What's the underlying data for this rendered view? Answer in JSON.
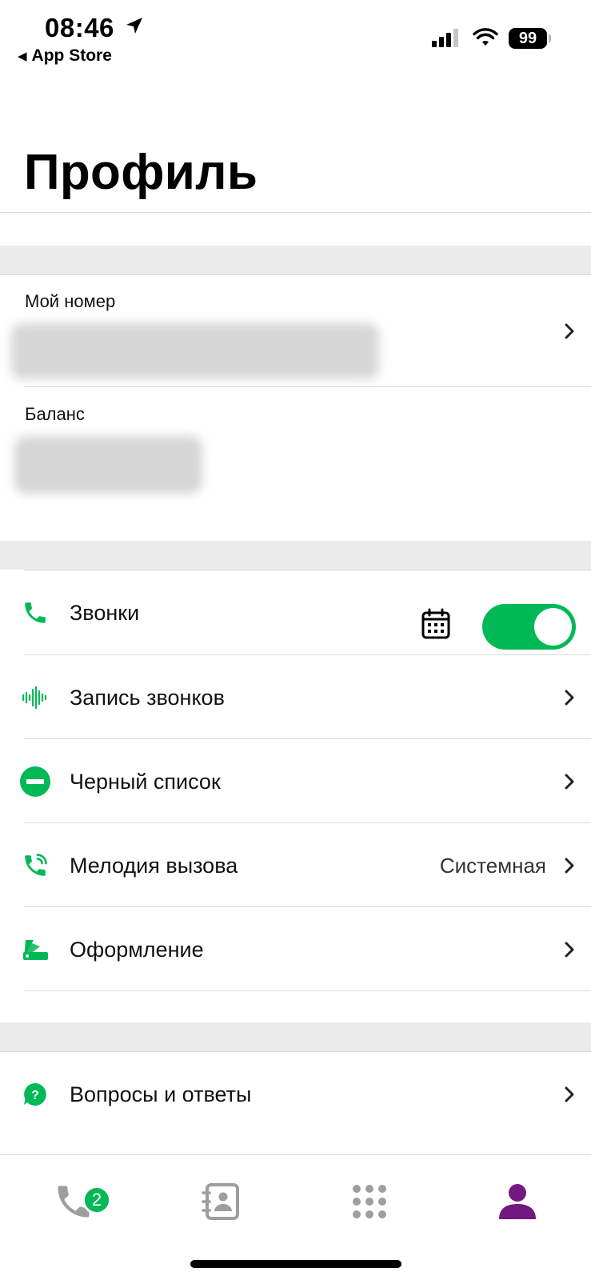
{
  "status_bar": {
    "time": "08:46",
    "back_label": "App Store",
    "battery": "99"
  },
  "page": {
    "title": "Профиль"
  },
  "account": {
    "my_number_label": "Мой номер",
    "balance_label": "Баланс"
  },
  "settings": {
    "calls_label": "Звонки",
    "calls_enabled": true,
    "recording_label": "Запись звонков",
    "blacklist_label": "Черный список",
    "ringtone_label": "Мелодия вызова",
    "ringtone_value": "Системная",
    "appearance_label": "Оформление"
  },
  "help": {
    "faq_label": "Вопросы и ответы"
  },
  "tabbar": {
    "calls_badge": "2",
    "active_tab": "profile"
  },
  "colors": {
    "accent_green": "#00b956",
    "active_purple": "#731982",
    "inactive_gray": "#9e9e9e"
  }
}
